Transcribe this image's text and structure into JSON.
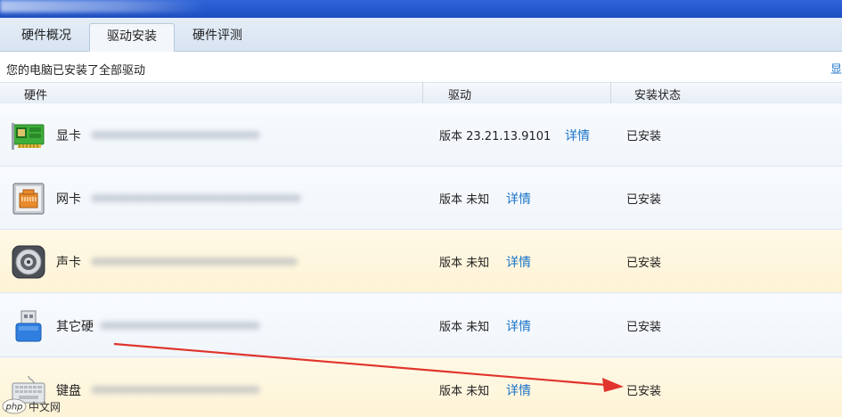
{
  "tabs": [
    {
      "label": "硬件概况",
      "active": false
    },
    {
      "label": "驱动安装",
      "active": true
    },
    {
      "label": "硬件评测",
      "active": false
    }
  ],
  "status": {
    "text": "您的电脑已安装了全部驱动",
    "link": "显"
  },
  "table": {
    "columns": [
      "硬件",
      "驱动",
      "安装状态"
    ],
    "rows": [
      {
        "hardware": "显卡",
        "version": "版本 23.21.13.9101",
        "detail": "详情",
        "state": "已安装",
        "highlight": false,
        "icon": "graphics-card-icon"
      },
      {
        "hardware": "网卡",
        "version": "版本 未知",
        "detail": "详情",
        "state": "已安装",
        "highlight": false,
        "icon": "network-card-icon"
      },
      {
        "hardware": "声卡",
        "version": "版本 未知",
        "detail": "详情",
        "state": "已安装",
        "highlight": true,
        "icon": "speaker-icon"
      },
      {
        "hardware": "其它硬",
        "version": "版本 未知",
        "detail": "详情",
        "state": "已安装",
        "highlight": false,
        "icon": "usb-device-icon"
      },
      {
        "hardware": "键盘",
        "version": "版本 未知",
        "detail": "详情",
        "state": "已安装",
        "highlight": true,
        "icon": "keyboard-icon"
      }
    ]
  },
  "watermark": {
    "brand": "php",
    "text": "中文网"
  },
  "colors": {
    "titlebar": "#2457cc",
    "link": "#1a73c8",
    "arrow": "#e0342c",
    "highlight_row": "#fdf3d6"
  }
}
